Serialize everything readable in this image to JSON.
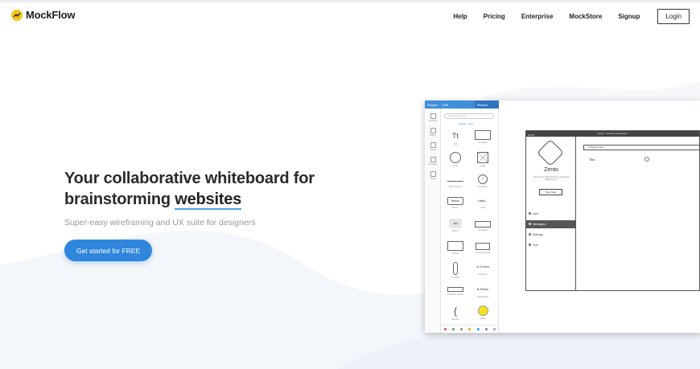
{
  "brand": {
    "name": "MockFlow",
    "accent": "#2f86dc",
    "logo_color": "#f5c518"
  },
  "nav": {
    "items": [
      "Help",
      "Pricing",
      "Enterprise",
      "MockStore",
      "Signup"
    ],
    "login_label": "Login"
  },
  "hero": {
    "title_line1": "Your collaborative whiteboard for",
    "title_line2_prefix": "brainstorming ",
    "title_line2_highlight": "websites",
    "subtitle": "Super-easy wireframing and UX suite for designers",
    "cta_label": "Get started for FREE"
  },
  "app_preview": {
    "topbar": {
      "left": [
        "Wraper",
        "Edit"
      ],
      "right": "Review"
    },
    "rail": [
      "Symbols",
      "Pages",
      "Assets",
      "Templates",
      "Theme"
    ],
    "palette": {
      "search_placeholder": "search for assets",
      "tag": "default · basic",
      "items": [
        "Text",
        "Rectangle",
        "Circle",
        "Image",
        "Horizontal Line",
        "Info Button",
        "Button",
        "Label",
        "Banner",
        "Textspace",
        "Textbox",
        "Numeric Stepper",
        "Scrollbar",
        "Checkbox",
        "Dropdown Combo",
        "Radio Button",
        "Bracket",
        "Callout"
      ],
      "item_texts": {
        "t": "Tt",
        "button": "Button",
        "label": "Label...",
        "ad": "Ad",
        "check": "Check",
        "radio": "Radio",
        "brace": "{"
      }
    },
    "wireframe": {
      "window_title": "Zento - Desktop Application",
      "app_name": "Zento",
      "app_desc": "Lorem ipsum dolor sit amet, consectetur adipiscing elit",
      "new_task": "New Task",
      "menu": [
        "User",
        "Messages",
        "Settings",
        "Grid"
      ],
      "active_menu": 1,
      "search_placeholder": "Search Here",
      "content_title": "Title"
    }
  }
}
